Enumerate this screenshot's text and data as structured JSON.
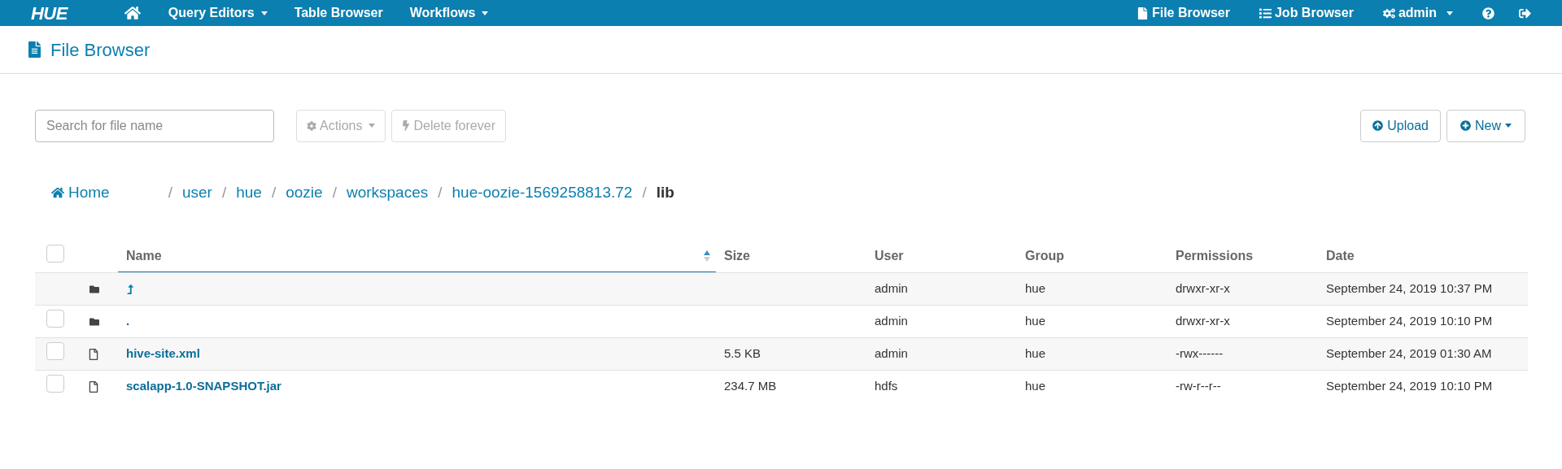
{
  "navbar": {
    "logo": "HUE",
    "left": [
      {
        "label": "Query Editors",
        "dropdown": true
      },
      {
        "label": "Table Browser",
        "dropdown": false
      },
      {
        "label": "Workflows",
        "dropdown": true
      }
    ],
    "right": [
      {
        "label": "File Browser",
        "dropdown": false
      },
      {
        "label": "Job Browser",
        "dropdown": false
      },
      {
        "label": "admin",
        "dropdown": true
      }
    ]
  },
  "page_title": "File Browser",
  "toolbar": {
    "search": {
      "placeholder": "Search for file name"
    },
    "actions": [
      {
        "label": "Actions",
        "disabled": true
      },
      {
        "label": "Delete forever",
        "disabled": true
      }
    ],
    "upload": "Upload",
    "new": "New"
  },
  "breadcrumbs": {
    "home": "Home",
    "parts": [
      {
        "label": "user",
        "current": false
      },
      {
        "label": "hue",
        "current": false
      },
      {
        "label": "oozie",
        "current": false
      },
      {
        "label": "workspaces",
        "current": false
      },
      {
        "label": "hue-oozie-1569258813.72",
        "current": false
      },
      {
        "label": "lib",
        "current": true
      }
    ],
    "separator": "/"
  },
  "table": {
    "columns": [
      {
        "label": "Name",
        "sorted": true
      },
      {
        "label": "Size",
        "sorted": false
      },
      {
        "label": "User",
        "sorted": false
      },
      {
        "label": "Group",
        "sorted": false
      },
      {
        "label": "Permissions",
        "sorted": false
      },
      {
        "label": "Date",
        "sorted": false
      }
    ],
    "all_checked": false,
    "rows": [
      {
        "kind": "parent",
        "name": "",
        "size": "",
        "user": "admin",
        "group": "hue",
        "permissions": "drwxr-xr-x",
        "date": "September 24, 2019 10:37 PM"
      },
      {
        "kind": "folder",
        "checked": false,
        "name": ".",
        "size": "",
        "user": "admin",
        "group": "hue",
        "permissions": "drwxr-xr-x",
        "date": "September 24, 2019 10:10 PM"
      },
      {
        "kind": "file",
        "checked": false,
        "name": "hive-site.xml",
        "size": "5.5 KB",
        "user": "admin",
        "group": "hue",
        "permissions": "-rwx------",
        "date": "September 24, 2019 01:30 AM"
      },
      {
        "kind": "file",
        "checked": false,
        "name": "scalapp-1.0-SNAPSHOT.jar",
        "size": "234.7 MB",
        "user": "hdfs",
        "group": "hue",
        "permissions": "-rw-r--r--",
        "date": "September 24, 2019 10:10 PM"
      }
    ]
  }
}
